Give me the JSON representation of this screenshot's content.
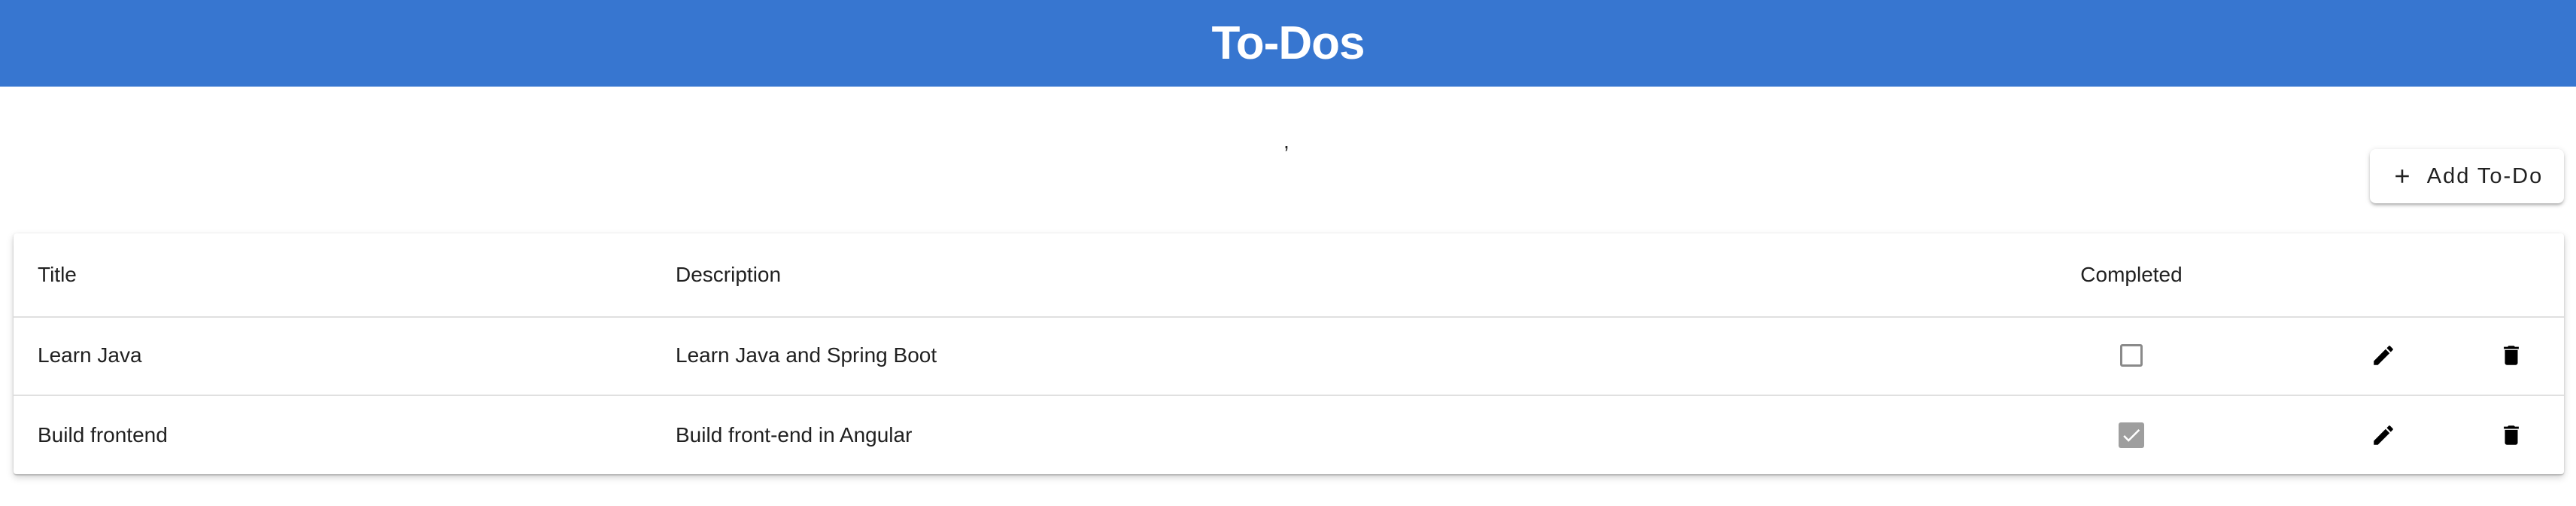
{
  "header": {
    "title": "To-Dos"
  },
  "stray_mark": ",",
  "toolbar": {
    "add_label": "Add To-Do",
    "add_icon": "plus-icon"
  },
  "table": {
    "columns": {
      "title": "Title",
      "description": "Description",
      "completed": "Completed"
    },
    "rows": [
      {
        "title": "Learn Java",
        "description": "Learn Java and Spring Boot",
        "completed": false
      },
      {
        "title": "Build frontend",
        "description": "Build front-end in Angular",
        "completed": true
      }
    ],
    "row_icons": {
      "edit": "pencil-icon",
      "delete": "trash-icon"
    }
  },
  "colors": {
    "header_bg": "#3776d0",
    "header_text": "#ffffff",
    "checkbox_checked": "#9e9e9e",
    "checkbox_border": "#8a8a8a"
  }
}
